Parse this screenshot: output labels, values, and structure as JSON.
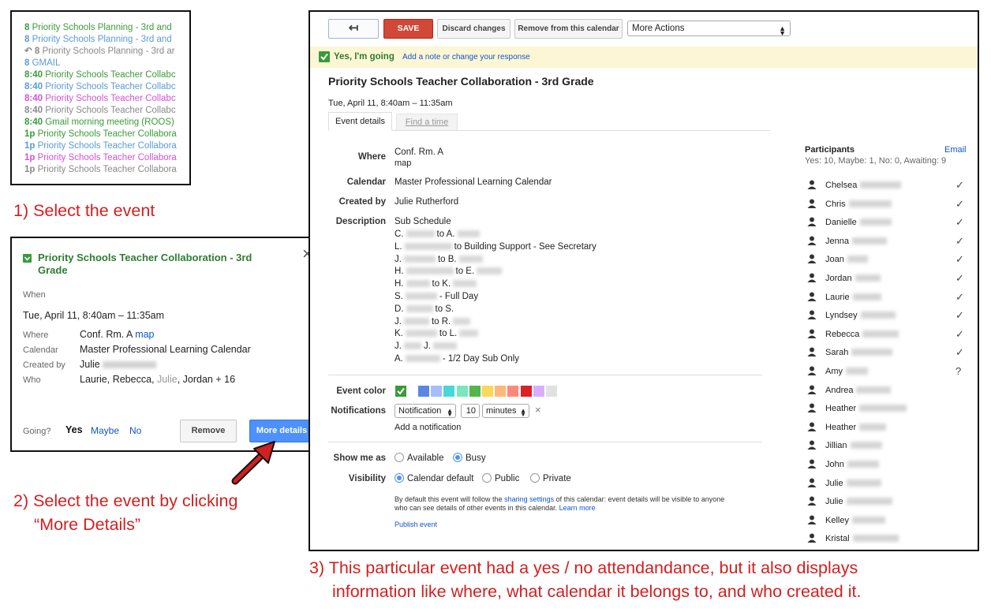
{
  "panel1": {
    "rows": [
      {
        "time": "8",
        "title": "Priority Schools Planning - 3rd and",
        "color": "green"
      },
      {
        "time": "8",
        "title": "Priority Schools Planning - 3rd and",
        "color": "blue"
      },
      {
        "time": "↶ 8",
        "title": "Priority Schools Planning - 3rd ar",
        "color": "gray"
      },
      {
        "time": "8",
        "title": "GMAIL",
        "color": "blue"
      },
      {
        "time": "8:40",
        "title": "Priority Schools Teacher Collabc",
        "color": "green"
      },
      {
        "time": "8:40",
        "title": "Priority Schools Teacher Collabc",
        "color": "blue"
      },
      {
        "time": "8:40",
        "title": "Priority Schools Teacher Collabc",
        "color": "pink"
      },
      {
        "time": "8:40",
        "title": "Priority Schools Teacher Collabc",
        "color": "gray"
      },
      {
        "time": "8:40",
        "title": "Gmail morning meeting (ROOS)",
        "color": "green"
      },
      {
        "time": "1p",
        "title": "Priority Schools Teacher Collabora",
        "color": "green"
      },
      {
        "time": "1p",
        "title": "Priority Schools Teacher Collabora",
        "color": "blue"
      },
      {
        "time": "1p",
        "title": "Priority Schools Teacher Collabora",
        "color": "pink"
      },
      {
        "time": "1p",
        "title": "Priority Schools Teacher Collabora",
        "color": "gray"
      }
    ]
  },
  "captions": {
    "step1": "1) Select the event",
    "step2_line1": "2) Select the event by clicking",
    "step2_line2": "“More Details”",
    "step3_line1": "3) This particular event had a yes / no attendandance, but it also displays",
    "step3_line2": "information like where, what calendar it belongs to, and who created it."
  },
  "popup": {
    "title": "Priority Schools Teacher Collaboration - 3rd Grade",
    "close": "×",
    "when_label": "When",
    "when_value": "Tue, April 11, 8:40am – 11:35am",
    "where_label": "Where",
    "where_value": "Conf. Rm. A",
    "map_link": "map",
    "calendar_label": "Calendar",
    "calendar_value": "Master Professional Learning Calendar",
    "createdby_label": "Created by",
    "createdby_value": "Julie",
    "who_label": "Who",
    "who_value_a": "Laurie, Rebecca, ",
    "who_value_b": "Julie",
    "who_value_c": ", Jordan + 16",
    "going_label": "Going?",
    "yes": "Yes",
    "maybe": "Maybe",
    "no": "No",
    "remove_button": "Remove",
    "more_details_button": "More details"
  },
  "details": {
    "back_icon": "↤",
    "save_button": "SAVE",
    "discard_button": "Discard changes",
    "remove_button": "Remove from this calendar",
    "more_actions": "More Actions",
    "rsvp_status": "Yes, I'm going",
    "rsvp_link": "Add a note or change your response",
    "title": "Priority Schools Teacher Collaboration - 3rd Grade",
    "datetime": "Tue, April 11, 8:40am – 11:35am",
    "tab_details": "Event details",
    "tab_find": "Find a time",
    "where_label": "Where",
    "where_value": "Conf. Rm. A",
    "map_link": "map",
    "calendar_label": "Calendar",
    "calendar_value": "Master Professional Learning Calendar",
    "createdby_label": "Created by",
    "createdby_value": "Julie Rutherford",
    "description_label": "Description",
    "description_heading": "Sub Schedule",
    "description_lines": [
      {
        "a": "C.",
        "b": "to A.",
        "c": ""
      },
      {
        "a": "L.",
        "b": "to Building Support - See Secretary",
        "c": ""
      },
      {
        "a": "J.",
        "b": "to B.",
        "c": ""
      },
      {
        "a": "H.",
        "b": "to E.",
        "c": ""
      },
      {
        "a": "H.",
        "b": "to K.",
        "c": ""
      },
      {
        "a": "S.",
        "b": "- Full Day",
        "c": ""
      },
      {
        "a": "D.",
        "b": "to S.",
        "c": ""
      },
      {
        "a": "J.",
        "b": "to R.",
        "c": ""
      },
      {
        "a": "K.",
        "b": "to L.",
        "c": ""
      },
      {
        "a": "J.",
        "b": "J.",
        "c": ""
      },
      {
        "a": "A.",
        "b": "- 1/2 Day Sub Only",
        "c": ""
      }
    ],
    "event_color_label": "Event color",
    "notifications_label": "Notifications",
    "notification_type": "Notification",
    "notification_amount": "10",
    "notification_unit": "minutes",
    "add_notification": "Add a notification",
    "show_me_as_label": "Show me as",
    "available": "Available",
    "busy": "Busy",
    "visibility_label": "Visibility",
    "vis_default": "Calendar default",
    "vis_public": "Public",
    "vis_private": "Private",
    "vis_note_a": "By default this event will follow the ",
    "vis_note_link": "sharing settings",
    "vis_note_b": " of this calendar: event details will be visible to anyone",
    "vis_note_c": "who can see details of other events in this calendar. ",
    "learn_more": "Learn more",
    "publish_event": "Publish event",
    "swatch_colors": [
      "#3a9a3a",
      "#5b86e5",
      "#a4bdfc",
      "#46d6db",
      "#7ae7bf",
      "#51b749",
      "#fbd75b",
      "#ffb878",
      "#ff887c",
      "#dc2127",
      "#dbadff",
      "#e1e1e1"
    ]
  },
  "participants": {
    "heading": "Participants",
    "email_link": "Email",
    "summary": "Yes: 10, Maybe: 1, No: 0, Awaiting: 9",
    "list": [
      {
        "name": "Chelsea",
        "rsvp": "✓"
      },
      {
        "name": "Chris",
        "rsvp": "✓"
      },
      {
        "name": "Danielle",
        "rsvp": "✓"
      },
      {
        "name": "Jenna",
        "rsvp": "✓"
      },
      {
        "name": "Joan",
        "rsvp": "✓"
      },
      {
        "name": "Jordan",
        "rsvp": "✓"
      },
      {
        "name": "Laurie",
        "rsvp": "✓"
      },
      {
        "name": "Lyndsey",
        "rsvp": "✓"
      },
      {
        "name": "Rebecca",
        "rsvp": "✓"
      },
      {
        "name": "Sarah",
        "rsvp": "✓"
      },
      {
        "name": "Amy",
        "rsvp": "?"
      },
      {
        "name": "Andrea",
        "rsvp": ""
      },
      {
        "name": "Heather",
        "rsvp": ""
      },
      {
        "name": "Heather",
        "rsvp": ""
      },
      {
        "name": "Jillian",
        "rsvp": ""
      },
      {
        "name": "John",
        "rsvp": ""
      },
      {
        "name": "Julie",
        "rsvp": ""
      },
      {
        "name": "Julie",
        "rsvp": ""
      },
      {
        "name": "Kelley",
        "rsvp": ""
      },
      {
        "name": "Kristal",
        "rsvp": ""
      }
    ]
  }
}
